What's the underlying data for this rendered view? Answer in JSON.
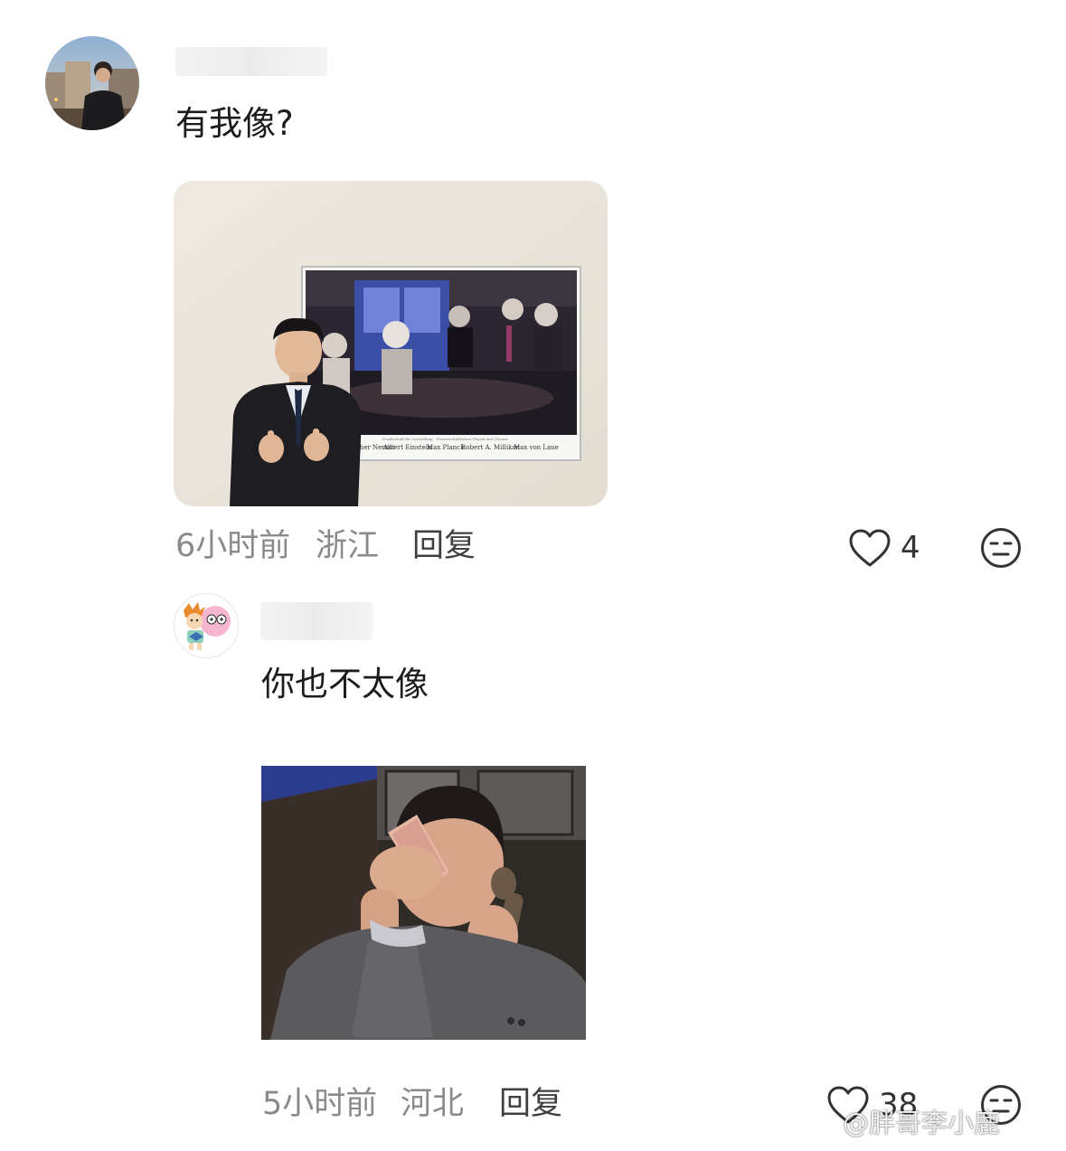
{
  "comments": [
    {
      "text": "有我像?",
      "photo_caption_names": [
        "Walther Nernst",
        "Albert Einstein",
        "Max Planck",
        "Robert A. Millikan",
        "Max von Laue"
      ],
      "time": "6小时前",
      "location": "浙江",
      "reply_label": "回复",
      "likes": "4"
    },
    {
      "text": "你也不太像",
      "time": "5小时前",
      "location": "河北",
      "reply_label": "回复",
      "likes": "38"
    }
  ],
  "icons": {
    "like": "heart-outline-icon",
    "reaction": "expressionless-face-icon"
  },
  "watermark": "@胖哥李小鹿",
  "colors": {
    "meta_text": "#8a8a8a",
    "reply_text": "#404040",
    "body_text": "#1c1c1c"
  }
}
